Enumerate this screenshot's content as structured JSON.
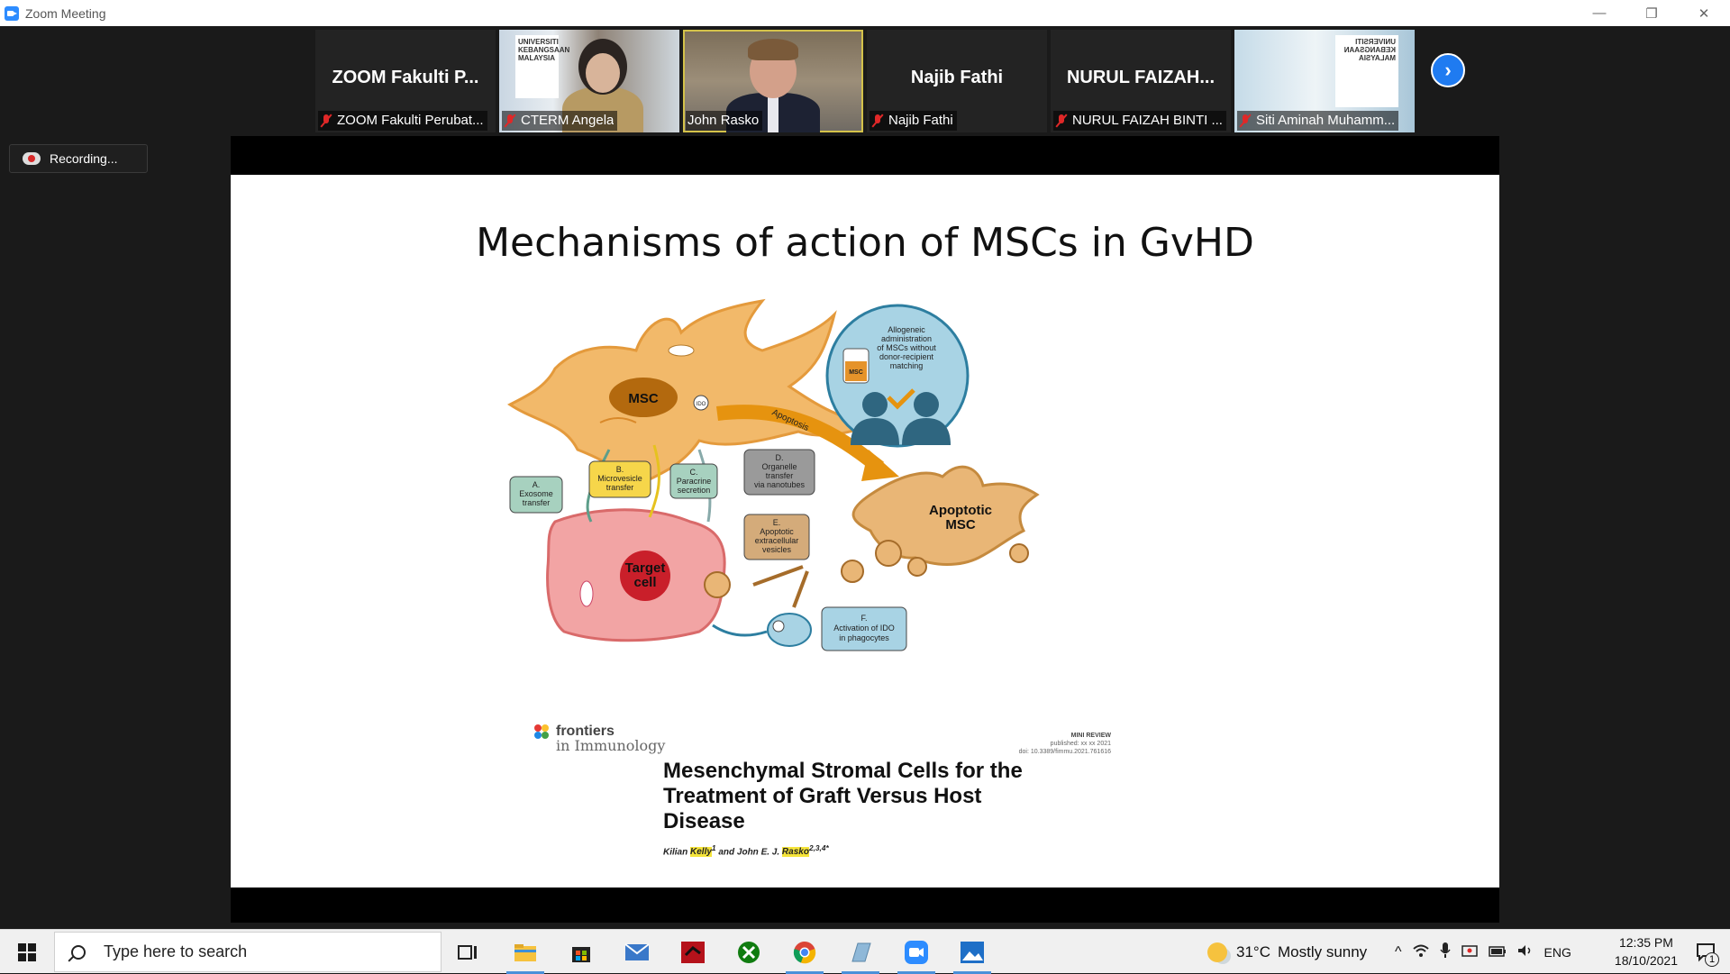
{
  "window": {
    "title": "Zoom Meeting",
    "controls": [
      "—",
      "❐",
      "✕"
    ]
  },
  "gallery": {
    "tiles": [
      {
        "big_name": "ZOOM Fakulti P...",
        "tag": "ZOOM Fakulti Perubat...",
        "muted": true,
        "video": false
      },
      {
        "big_name": "",
        "tag": "CTERM Angela",
        "muted": true,
        "video": true
      },
      {
        "big_name": "",
        "tag": "John Rasko",
        "muted": false,
        "video": true,
        "active": true
      },
      {
        "big_name": "Najib Fathi",
        "tag": "Najib Fathi",
        "muted": true,
        "video": false
      },
      {
        "big_name": "NURUL FAIZAH...",
        "tag": "NURUL FAIZAH BINTI ...",
        "muted": true,
        "video": false
      },
      {
        "big_name": "",
        "tag": "Siti Aminah Muhamm...",
        "muted": true,
        "video": true
      }
    ],
    "angela_poster": "UNIVERSITI KEBANGSAAN MALAYSIA",
    "siti_poster": "UNIVERSITI KEBANGSAAN MALAYSIA",
    "next_icon": "chevron-right-icon"
  },
  "recording": {
    "label": "Recording..."
  },
  "slide": {
    "title": "Mechanisms of action of MSCs in GvHD",
    "diagram": {
      "msc": "MSC",
      "ido": "IDO",
      "apoptosis": "Apoptosis",
      "apoptotic_msc_1": "Apoptotic",
      "apoptotic_msc_2": "MSC",
      "target_1": "Target",
      "target_2": "cell",
      "circle_text": [
        "Allogeneic",
        "administration",
        "of MSCs without",
        "donor-recipient",
        "matching"
      ],
      "bag_label": "MSC",
      "box_a": [
        "A.",
        "Exosome",
        "transfer"
      ],
      "box_b": [
        "B.",
        "Microvesicle",
        "transfer"
      ],
      "box_c": [
        "C.",
        "Paracrine",
        "secretion"
      ],
      "box_d": [
        "D.",
        "Organelle",
        "transfer",
        "via nanotubes"
      ],
      "box_e": [
        "E.",
        "Apoptotic",
        "extracellular",
        "vesicles"
      ],
      "box_f": [
        "F.",
        "Activation of IDO",
        "in phagocytes"
      ]
    },
    "journal": {
      "logo_line1": "frontiers",
      "logo_line2": "in Immunology",
      "meta_type": "MINI REVIEW",
      "meta_published": "published: xx xx 2021",
      "meta_doi": "doi: 10.3389/fimmu.2021.761616",
      "paper_title": "Mesenchymal Stromal Cells for the Treatment of Graft Versus Host Disease",
      "author1_first": "Kilian",
      "author1_last": "Kelly",
      "author1_sup": "1",
      "and": "and John E. J.",
      "author2_last": "Rasko",
      "author2_sup": "2,3,4*"
    }
  },
  "taskbar": {
    "search_placeholder": "Type here to search",
    "apps": [
      "task-view-icon",
      "file-explorer-icon",
      "store-icon",
      "mail-icon",
      "app-red-icon",
      "xbox-icon",
      "chrome-icon",
      "app-notes-icon",
      "zoom-icon",
      "photos-icon"
    ],
    "weather_temp": "31°C",
    "weather_desc": "Mostly sunny",
    "language": "ENG",
    "time": "12:35 PM",
    "date": "18/10/2021",
    "notif_count": "1"
  }
}
